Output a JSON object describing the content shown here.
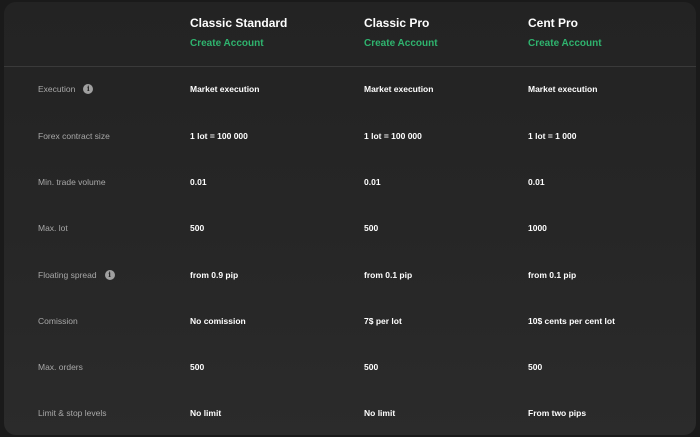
{
  "plans": [
    {
      "name": "Classic Standard",
      "cta": "Create Account"
    },
    {
      "name": "Classic Pro",
      "cta": "Create Account"
    },
    {
      "name": "Cent Pro",
      "cta": "Create Account"
    }
  ],
  "rows": [
    {
      "label": "Execution",
      "info_icon": "info-icon",
      "values": [
        "Market execution",
        "Market execution",
        "Market execution"
      ]
    },
    {
      "label": "Forex contract size",
      "values": [
        "1 lot = 100 000",
        "1 lot = 100 000",
        "1 lot = 1 000"
      ]
    },
    {
      "label": "Min. trade volume",
      "values": [
        "0.01",
        "0.01",
        "0.01"
      ]
    },
    {
      "label": "Max. lot",
      "values": [
        "500",
        "500",
        "1000"
      ]
    },
    {
      "label": "Floating spread",
      "info_icon": "info-icon",
      "values": [
        "from 0.9 pip",
        "from 0.1 pip",
        "from 0.1 pip"
      ]
    },
    {
      "label": "Comission",
      "values": [
        "No comission",
        "7$ per lot",
        "10$ cents per cent lot"
      ]
    },
    {
      "label": "Max. orders",
      "values": [
        "500",
        "500",
        "500"
      ]
    },
    {
      "label": "Limit & stop levels",
      "values": [
        "No limit",
        "No limit",
        "From two pips"
      ]
    }
  ],
  "colors": {
    "background": "#1a1a1a",
    "panel": "#262626",
    "accent": "#2fb36e",
    "label_text": "#a8a8a8",
    "value_text": "#ffffff"
  }
}
